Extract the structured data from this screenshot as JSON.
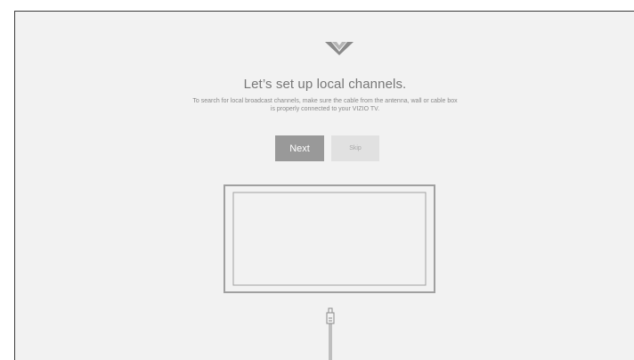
{
  "setup": {
    "title": "Let’s set up local channels.",
    "description": "To search for local broadcast channels, make sure the cable from the antenna, wall or cable box is properly connected to your VIZIO TV.",
    "next_label": "Next",
    "skip_label": "Skip"
  },
  "icons": {
    "logo": "vizio-v-logo-icon",
    "tv": "tv-outline-icon",
    "cable": "coax-cable-icon"
  },
  "colors": {
    "background": "#f2f2f2",
    "primary_button": "#999999",
    "secondary_button": "#e1e1e1",
    "text": "#777777"
  }
}
